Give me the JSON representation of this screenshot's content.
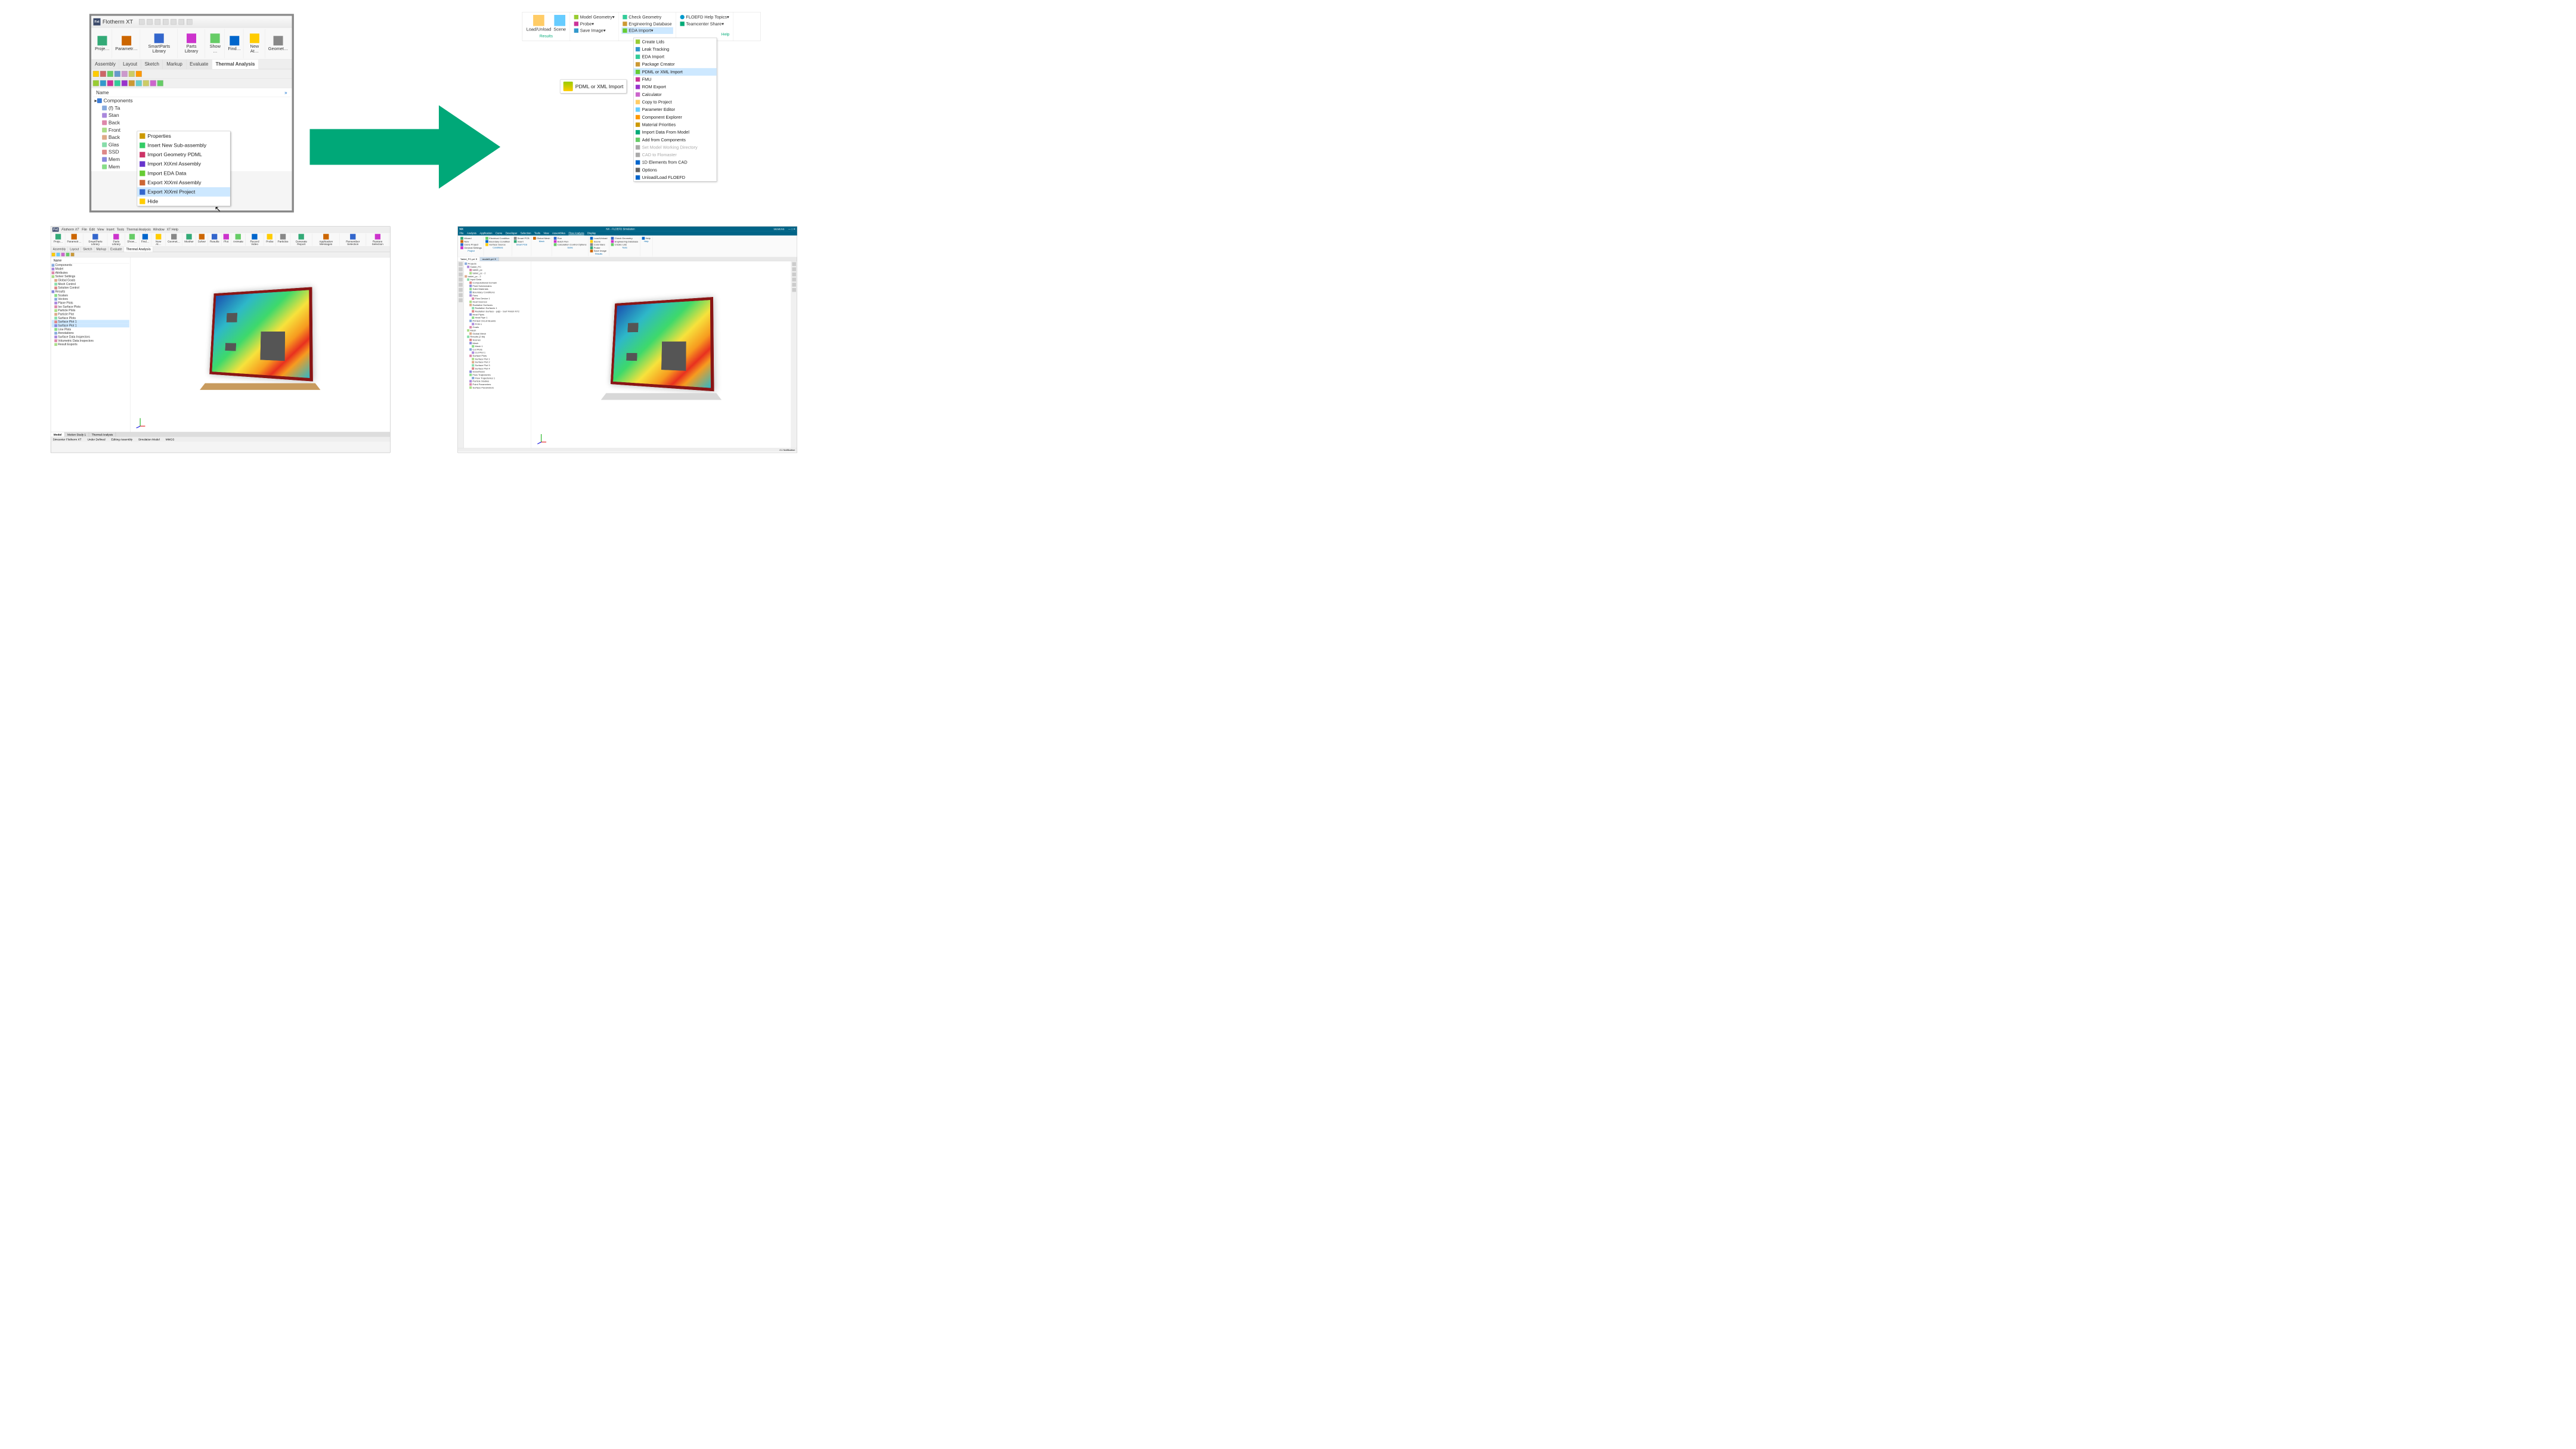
{
  "top_left": {
    "app_title": "Flotherm XT",
    "app_icon_text": "Fxt",
    "ribbon_buttons": [
      "Proje…",
      "Parametr…",
      "SmartParts Library",
      "Parts Library",
      "Show …",
      "Find…",
      "New At…",
      "Geomet…"
    ],
    "tabs": [
      "Assembly",
      "Layout",
      "Sketch",
      "Markup",
      "Evaluate",
      "Thermal Analysis"
    ],
    "active_tab": "Thermal Analysis",
    "tree_header": "Name",
    "tree_root": "Components",
    "tree_items": [
      "(f) Ta",
      "Stan",
      "Back",
      "Front",
      "Back",
      "Glas",
      "SSD",
      "Mem",
      "Mem"
    ],
    "context_menu": [
      "Properties",
      "Insert New Sub-assembly",
      "Import Geometry PDML",
      "Import XtXml Assembly",
      "Import EDA Data",
      "Export XtXml Assembly",
      "Export XtXml Project",
      "Hide"
    ],
    "context_highlight": "Export XtXml Project"
  },
  "top_right": {
    "ribbon": {
      "big_buttons": [
        "Load/Unload",
        "Scene"
      ],
      "col1": [
        "Model Geometry",
        "Probe",
        "Save Image"
      ],
      "col2": [
        "Check Geometry",
        "Engineering Database",
        "EDA Import"
      ],
      "col3": [
        "FLOEFD Help Topics",
        "Teamcenter Share"
      ],
      "group_labels": [
        "Results",
        "",
        "Help"
      ]
    },
    "callout": "PDML or XML Import",
    "menu": [
      {
        "label": "Create Lids",
        "state": "normal"
      },
      {
        "label": "Leak Tracking",
        "state": "normal"
      },
      {
        "label": "EDA Import",
        "state": "normal"
      },
      {
        "label": "Package Creator",
        "state": "normal"
      },
      {
        "label": "PDML or XML Import",
        "state": "highlight"
      },
      {
        "label": "FMU",
        "state": "normal"
      },
      {
        "label": "ROM Export",
        "state": "normal"
      },
      {
        "label": "Calculator",
        "state": "normal"
      },
      {
        "label": "Copy to Project",
        "state": "normal"
      },
      {
        "label": "Parameter Editor",
        "state": "normal"
      },
      {
        "label": "Component Explorer",
        "state": "normal"
      },
      {
        "label": "Material Priorities",
        "state": "normal"
      },
      {
        "label": "Import Data From Model",
        "state": "normal"
      },
      {
        "label": "Add from Components",
        "state": "normal"
      },
      {
        "label": "Set Model Working Directory",
        "state": "disabled"
      },
      {
        "label": "CAD to Flomaster",
        "state": "disabled"
      },
      {
        "label": "1D Elements from CAD",
        "state": "normal"
      },
      {
        "label": "Options",
        "state": "normal"
      },
      {
        "label": "Unload/Load FLOEFD",
        "state": "normal"
      }
    ]
  },
  "bottom_left": {
    "app_title": "Flotherm XT",
    "menubar": [
      "File",
      "Edit",
      "View",
      "Insert",
      "Tools",
      "Thermal Analysis",
      "Window",
      "XT Help"
    ],
    "ribbon": [
      "Proje…",
      "Parametr…",
      "SmartParts Library",
      "Parts Library",
      "Show…",
      "Find…",
      "New At…",
      "Geomet…",
      "Mesher",
      "Solver",
      "Results",
      "Plot",
      "Animate",
      "Record Video",
      "Probe",
      "Particles",
      "Generate Report",
      "Application Messages",
      "Remember Selection",
      "Restore Selection"
    ],
    "tabs": [
      "Assembly",
      "Layout",
      "Sketch",
      "Markup",
      "Evaluate",
      "Thermal Analysis"
    ],
    "active_tab": "Thermal Analysis",
    "tree_header": "Name",
    "tree": {
      "Components": [],
      "Model": [],
      "Attributes": [],
      "Solver Settings": [
        "Global Goals",
        "Mesh Control",
        "Solution Control"
      ],
      "Results": [
        "Scalars",
        "Vectors",
        "Plane Plots",
        "Iso Surface Plots",
        "Particle Plots",
        "Particle Plot",
        "Surface Plots",
        "Surface Plot 1",
        "Surface Plot 1",
        "Line Plots",
        "Annotations",
        "Surface Data Inspectors",
        "Volumetric Data Inspectors",
        "Result Exports"
      ]
    },
    "selected_tree_item": "Surface Plot 1",
    "bottom_tabs": [
      "Model",
      "Motion Study 1",
      "Thermal Analysis"
    ],
    "active_bottom_tab": "Model",
    "status": [
      "Simcenter Flotherm XT",
      "Under Defined",
      "Editing Assembly",
      "Simulation Model",
      "MMGS"
    ]
  },
  "bottom_right": {
    "nx_label": "NX",
    "title": "NX - FLOEFD Simulation",
    "brand": "SIEMENS",
    "menubar": [
      "File",
      "Analysis",
      "Application",
      "Curve",
      "Developer",
      "Selection",
      "Tools",
      "View",
      "Assemblies",
      "Flow Analysis",
      "Display"
    ],
    "active_menu": "Flow Analysis",
    "ribbon_groups": {
      "Project": [
        "Wizard",
        "New",
        "Clone Project",
        "General Settings"
      ],
      "Conditions": [
        "Electrical Condition",
        "Boundary Condition",
        "Surface Source"
      ],
      "Smart PCB": [
        "Smart PCB",
        "Insert"
      ],
      "Mesh": [
        "Global Mesh"
      ],
      "Solve": [
        "Run",
        "Batch Run",
        "Calculation Control Options"
      ],
      "Results": [
        "Load/Unload",
        "Scene",
        "Color Bars",
        "Probe",
        "Save Image"
      ],
      "Tools": [
        "Check Geometry",
        "Engineering Database",
        "Create Lids"
      ],
      "Help": [
        "Help"
      ]
    },
    "doc_tabs": [
      "Tablet_PC.prt",
      "model1.prt"
    ],
    "active_doc_tab": "Tablet_PC.prt",
    "tree": [
      "Projects",
      "  Tablet_PC",
      "    tablet_pc",
      "    tablet_pc - 2",
      "tablet_pc - 2",
      "  Input Data",
      "    Computational Domain",
      "    Fluid Subdomains",
      "    Solid Materials",
      "    Boundary Conditions",
      "    Fans",
      "      Flow Device 1",
      "    Heat Sources",
      "    Radiative Surfaces",
      "      Radiation Surfaces 1",
      "      Radiation Surface - pqfp - Surf Finish NT2",
      "    Heat Pipes",
      "      Heat Pipe 1",
      "    Printed Circuit Boards",
      "      PCB 1",
      "    Goals",
      "  Mesh",
      "    Global Mesh",
      "  Results (2.fld)",
      "    Scenes",
      "    Mesh",
      "      Mesh 1",
      "    Cut Plots",
      "      Cut Plot 1",
      "    Surface Plots",
      "      Surface Plot 1",
      "      Surface Plot 2",
      "      Surface Plot 3",
      "      Surface Plot 4",
      "    Isosurfaces",
      "    Flow Trajectories",
      "      Flow Trajectories 1",
      "    Particle Studies",
      "    Point Parameters",
      "    Surface Parameters"
    ],
    "status": "1 Notification"
  }
}
